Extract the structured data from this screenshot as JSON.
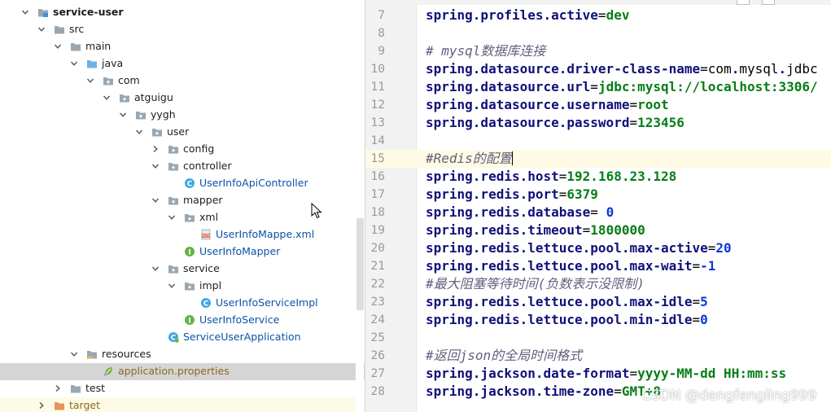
{
  "tree": {
    "items": [
      {
        "label": "service-user",
        "depth": 0,
        "expanded": true,
        "icon": "module-folder-icon",
        "style": "bold"
      },
      {
        "label": "src",
        "depth": 1,
        "expanded": true,
        "icon": "folder-icon"
      },
      {
        "label": "main",
        "depth": 2,
        "expanded": true,
        "icon": "folder-icon"
      },
      {
        "label": "java",
        "depth": 3,
        "expanded": true,
        "icon": "source-folder-icon"
      },
      {
        "label": "com",
        "depth": 4,
        "expanded": true,
        "icon": "package-icon"
      },
      {
        "label": "atguigu",
        "depth": 5,
        "expanded": true,
        "icon": "package-icon"
      },
      {
        "label": "yygh",
        "depth": 6,
        "expanded": true,
        "icon": "package-icon"
      },
      {
        "label": "user",
        "depth": 7,
        "expanded": true,
        "icon": "package-icon"
      },
      {
        "label": "config",
        "depth": 8,
        "expanded": false,
        "icon": "package-icon"
      },
      {
        "label": "controller",
        "depth": 8,
        "expanded": true,
        "icon": "package-icon"
      },
      {
        "label": "UserInfoApiController",
        "depth": 9,
        "icon": "class-icon",
        "style": "blue"
      },
      {
        "label": "mapper",
        "depth": 8,
        "expanded": true,
        "icon": "package-icon"
      },
      {
        "label": "xml",
        "depth": 9,
        "expanded": true,
        "icon": "package-icon"
      },
      {
        "label": "UserInfoMappe.xml",
        "depth": 10,
        "icon": "xml-file-icon",
        "style": "blue"
      },
      {
        "label": "UserInfoMapper",
        "depth": 9,
        "icon": "interface-icon",
        "style": "blue"
      },
      {
        "label": "service",
        "depth": 8,
        "expanded": true,
        "icon": "package-icon"
      },
      {
        "label": "impl",
        "depth": 9,
        "expanded": true,
        "icon": "package-icon"
      },
      {
        "label": "UserInfoServiceImpl",
        "depth": 10,
        "icon": "class-icon",
        "style": "blue"
      },
      {
        "label": "UserInfoService",
        "depth": 9,
        "icon": "interface-icon",
        "style": "blue"
      },
      {
        "label": "ServiceUserApplication",
        "depth": 8,
        "icon": "spring-boot-class-icon",
        "style": "blue"
      },
      {
        "label": "resources",
        "depth": 3,
        "expanded": true,
        "icon": "resources-folder-icon"
      },
      {
        "label": "application.properties",
        "depth": 4,
        "icon": "properties-file-icon",
        "style": "olive",
        "selected": true
      },
      {
        "label": "test",
        "depth": 2,
        "expanded": false,
        "icon": "folder-icon"
      },
      {
        "label": "target",
        "depth": 1,
        "expanded": false,
        "icon": "excluded-folder-icon",
        "style": "olive",
        "excluded": true
      }
    ]
  },
  "editor": {
    "current_line": 15,
    "lines": [
      {
        "n": "7",
        "parts": [
          [
            "k",
            "spring.profiles.active"
          ],
          [
            "eq",
            "="
          ],
          [
            "v",
            "dev"
          ]
        ]
      },
      {
        "n": "8",
        "parts": []
      },
      {
        "n": "9",
        "parts": [
          [
            "c",
            "# mysql数据库连接"
          ]
        ]
      },
      {
        "n": "10",
        "parts": [
          [
            "k",
            "spring.datasource.driver-class-name"
          ],
          [
            "eq",
            "="
          ],
          [
            "eq",
            "com"
          ],
          [
            "k",
            "."
          ],
          [
            "eq",
            "mysql"
          ],
          [
            "k",
            "."
          ],
          [
            "eq",
            "jdbc"
          ]
        ]
      },
      {
        "n": "11",
        "parts": [
          [
            "k",
            "spring.datasource.url"
          ],
          [
            "eq",
            "="
          ],
          [
            "v",
            "jdbc:mysql://localhost:3306/"
          ]
        ]
      },
      {
        "n": "12",
        "parts": [
          [
            "k",
            "spring.datasource.username"
          ],
          [
            "eq",
            "="
          ],
          [
            "v",
            "root"
          ]
        ]
      },
      {
        "n": "13",
        "parts": [
          [
            "k",
            "spring.datasource.password"
          ],
          [
            "eq",
            "="
          ],
          [
            "v",
            "123456"
          ]
        ]
      },
      {
        "n": "14",
        "parts": []
      },
      {
        "n": "15",
        "parts": [
          [
            "c",
            "#Redis的配置"
          ]
        ],
        "caret": true
      },
      {
        "n": "16",
        "parts": [
          [
            "k",
            "spring.redis.host"
          ],
          [
            "eq",
            "="
          ],
          [
            "v",
            "192.168.23.128"
          ]
        ]
      },
      {
        "n": "17",
        "parts": [
          [
            "k",
            "spring.redis.port"
          ],
          [
            "eq",
            "="
          ],
          [
            "v",
            "6379"
          ]
        ]
      },
      {
        "n": "18",
        "parts": [
          [
            "k",
            "spring.redis.database"
          ],
          [
            "eq",
            "= "
          ],
          [
            "n",
            "0"
          ]
        ]
      },
      {
        "n": "19",
        "parts": [
          [
            "k",
            "spring.redis.timeout"
          ],
          [
            "eq",
            "="
          ],
          [
            "v",
            "1800000"
          ]
        ]
      },
      {
        "n": "20",
        "parts": [
          [
            "k",
            "spring.redis.lettuce.pool.max-active"
          ],
          [
            "eq",
            "="
          ],
          [
            "n",
            "20"
          ]
        ]
      },
      {
        "n": "21",
        "parts": [
          [
            "k",
            "spring.redis.lettuce.pool.max-wait"
          ],
          [
            "eq",
            "="
          ],
          [
            "n",
            "-1"
          ]
        ]
      },
      {
        "n": "22",
        "parts": [
          [
            "c",
            "#最大阻塞等待时间(负数表示没限制)"
          ]
        ]
      },
      {
        "n": "23",
        "parts": [
          [
            "k",
            "spring.redis.lettuce.pool.max-idle"
          ],
          [
            "eq",
            "="
          ],
          [
            "n",
            "5"
          ]
        ]
      },
      {
        "n": "24",
        "parts": [
          [
            "k",
            "spring.redis.lettuce.pool.min-idle"
          ],
          [
            "eq",
            "="
          ],
          [
            "n",
            "0"
          ]
        ]
      },
      {
        "n": "25",
        "parts": []
      },
      {
        "n": "26",
        "parts": [
          [
            "c",
            "#返回json的全局时间格式"
          ]
        ]
      },
      {
        "n": "27",
        "parts": [
          [
            "k",
            "spring.jackson.date-format"
          ],
          [
            "eq",
            "="
          ],
          [
            "v",
            "yyyy-MM-dd HH:mm:ss"
          ]
        ]
      },
      {
        "n": "28",
        "parts": [
          [
            "k",
            "spring.jackson.time-zone"
          ],
          [
            "eq",
            "="
          ],
          [
            "v",
            "GMT+8"
          ]
        ]
      }
    ]
  },
  "watermark": "CSDN @dengfengling999",
  "colors": {
    "key": "#10107a",
    "value": "#067d17",
    "number": "#0b38d6",
    "comment": "#606080",
    "selection": "#d5d5d5",
    "caret_line": "#fffae3"
  }
}
